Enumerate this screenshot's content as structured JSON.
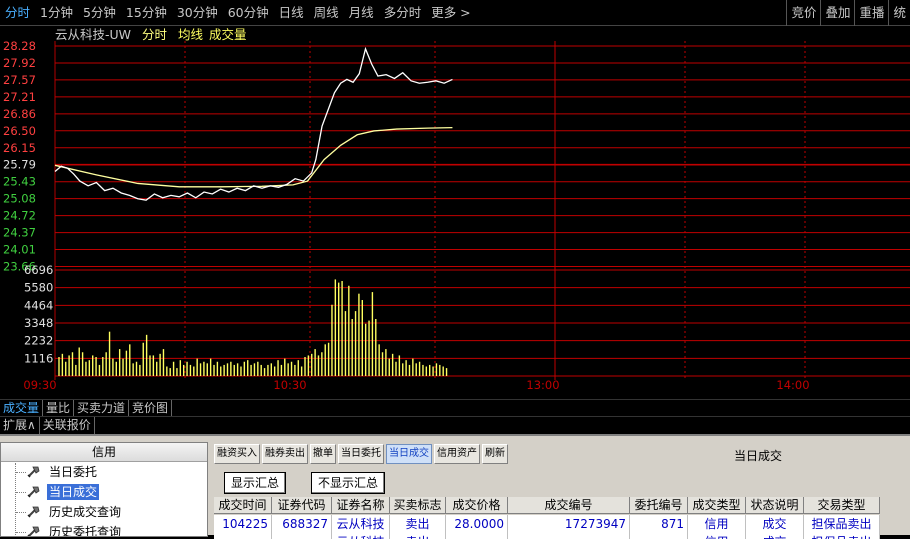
{
  "topbar": {
    "tabs": [
      "分时",
      "1分钟",
      "5分钟",
      "15分钟",
      "30分钟",
      "60分钟",
      "日线",
      "周线",
      "月线",
      "多分时",
      "更多 >"
    ],
    "active_index": 0,
    "right_tabs": [
      "竞价",
      "叠加",
      "重播",
      "统"
    ]
  },
  "chart_header": {
    "name": "云从科技-UW",
    "mode": "分时",
    "avg": "均线",
    "volume": "成交量"
  },
  "chart_data": {
    "type": "line",
    "price_ticks": [
      "28.28",
      "27.92",
      "27.57",
      "27.21",
      "26.86",
      "26.50",
      "26.15",
      "25.79",
      "25.43",
      "25.08",
      "24.72",
      "24.37",
      "24.01",
      "23.66"
    ],
    "prev_close": 25.79,
    "volume_ticks": [
      "6696",
      "5580",
      "4464",
      "3348",
      "2232",
      "1116"
    ],
    "time_ticks": [
      "09:30",
      "10:30",
      "13:00",
      "14:00"
    ],
    "price": [
      [
        0,
        25.65
      ],
      [
        3,
        25.76
      ],
      [
        6,
        25.72
      ],
      [
        9,
        25.6
      ],
      [
        12,
        25.45
      ],
      [
        16,
        25.35
      ],
      [
        20,
        25.42
      ],
      [
        24,
        25.25
      ],
      [
        28,
        25.3
      ],
      [
        32,
        25.2
      ],
      [
        36,
        25.15
      ],
      [
        40,
        25.08
      ],
      [
        44,
        25.05
      ],
      [
        48,
        25.18
      ],
      [
        52,
        25.1
      ],
      [
        56,
        25.15
      ],
      [
        60,
        25.12
      ],
      [
        64,
        25.2
      ],
      [
        68,
        25.1
      ],
      [
        72,
        25.22
      ],
      [
        76,
        25.18
      ],
      [
        80,
        25.28
      ],
      [
        84,
        25.22
      ],
      [
        88,
        25.3
      ],
      [
        92,
        25.25
      ],
      [
        96,
        25.35
      ],
      [
        100,
        25.3
      ],
      [
        104,
        25.35
      ],
      [
        108,
        25.32
      ],
      [
        112,
        25.38
      ],
      [
        116,
        25.5
      ],
      [
        120,
        25.45
      ],
      [
        124,
        25.62
      ],
      [
        126,
        25.9
      ],
      [
        129,
        26.6
      ],
      [
        132,
        26.95
      ],
      [
        135,
        27.3
      ],
      [
        138,
        27.5
      ],
      [
        141,
        27.58
      ],
      [
        144,
        27.52
      ],
      [
        147,
        27.7
      ],
      [
        150,
        28.22
      ],
      [
        153,
        27.9
      ],
      [
        156,
        27.65
      ],
      [
        160,
        27.68
      ],
      [
        164,
        27.6
      ],
      [
        168,
        27.72
      ],
      [
        172,
        27.55
      ],
      [
        176,
        27.5
      ],
      [
        180,
        27.52
      ],
      [
        184,
        27.55
      ],
      [
        188,
        27.5
      ],
      [
        192,
        27.58
      ]
    ],
    "avg": [
      [
        0,
        25.78
      ],
      [
        20,
        25.58
      ],
      [
        40,
        25.4
      ],
      [
        60,
        25.33
      ],
      [
        80,
        25.33
      ],
      [
        100,
        25.34
      ],
      [
        115,
        25.37
      ],
      [
        122,
        25.45
      ],
      [
        130,
        25.9
      ],
      [
        138,
        26.2
      ],
      [
        146,
        26.42
      ],
      [
        154,
        26.5
      ],
      [
        165,
        26.54
      ],
      [
        180,
        26.56
      ],
      [
        192,
        26.57
      ]
    ],
    "volume": [
      1200,
      1400,
      900,
      1300,
      1500,
      700,
      1800,
      1500,
      900,
      1000,
      1300,
      1200,
      700,
      1200,
      1500,
      2800,
      1100,
      900,
      1700,
      1100,
      1600,
      2000,
      800,
      900,
      700,
      2100,
      2600,
      1300,
      1300,
      900,
      1400,
      1700,
      600,
      500,
      900,
      500,
      1000,
      700,
      900,
      700,
      600,
      1100,
      800,
      900,
      800,
      1100,
      700,
      900,
      600,
      700,
      800,
      900,
      700,
      800,
      600,
      900,
      1000,
      700,
      800,
      900,
      700,
      500,
      700,
      800,
      600,
      1000,
      700,
      1100,
      800,
      900,
      700,
      1000,
      600,
      1200,
      1300,
      1400,
      1700,
      1300,
      1500,
      2000,
      2100,
      4500,
      6100,
      5900,
      6000,
      4100,
      5700,
      3600,
      4100,
      5200,
      4800,
      3300,
      3500,
      5300,
      3600,
      2000,
      1500,
      1700,
      1100,
      1400,
      900,
      1300,
      800,
      1000,
      700,
      1100,
      800,
      900,
      700,
      600,
      700,
      600,
      800,
      700,
      600,
      500
    ]
  },
  "indicator_bar": [
    "成交量",
    "量比",
    "买卖力道",
    "竞价图"
  ],
  "ext_bar": [
    "扩展∧",
    "关联报价"
  ],
  "tree": {
    "header": "信用",
    "items": [
      "当日委托",
      "当日成交",
      "历史成交查询",
      "历史委托查询"
    ],
    "selected": 1
  },
  "toolbar": [
    "融资买入",
    "融券卖出",
    "撤单",
    "当日委托",
    "当日成交",
    "信用资产",
    "刷新"
  ],
  "toolbar_active": 4,
  "panel_title": "当日成交",
  "summary": {
    "show": "显示汇总",
    "hide": "不显示汇总"
  },
  "table": {
    "headers": [
      "成交时间",
      "证券代码",
      "证券名称",
      "买卖标志",
      "成交价格",
      "成交编号",
      "委托编号",
      "成交类型",
      "状态说明",
      "交易类型"
    ],
    "rows": [
      [
        "104225",
        "688327",
        "云从科技",
        "卖出",
        "28.0000",
        "17273947",
        "871",
        "信用",
        "成交",
        "担保品卖出"
      ],
      [
        "",
        "",
        "云从科技",
        "卖出",
        "",
        "",
        "",
        "信用",
        "成交",
        "担保品卖出"
      ]
    ]
  }
}
